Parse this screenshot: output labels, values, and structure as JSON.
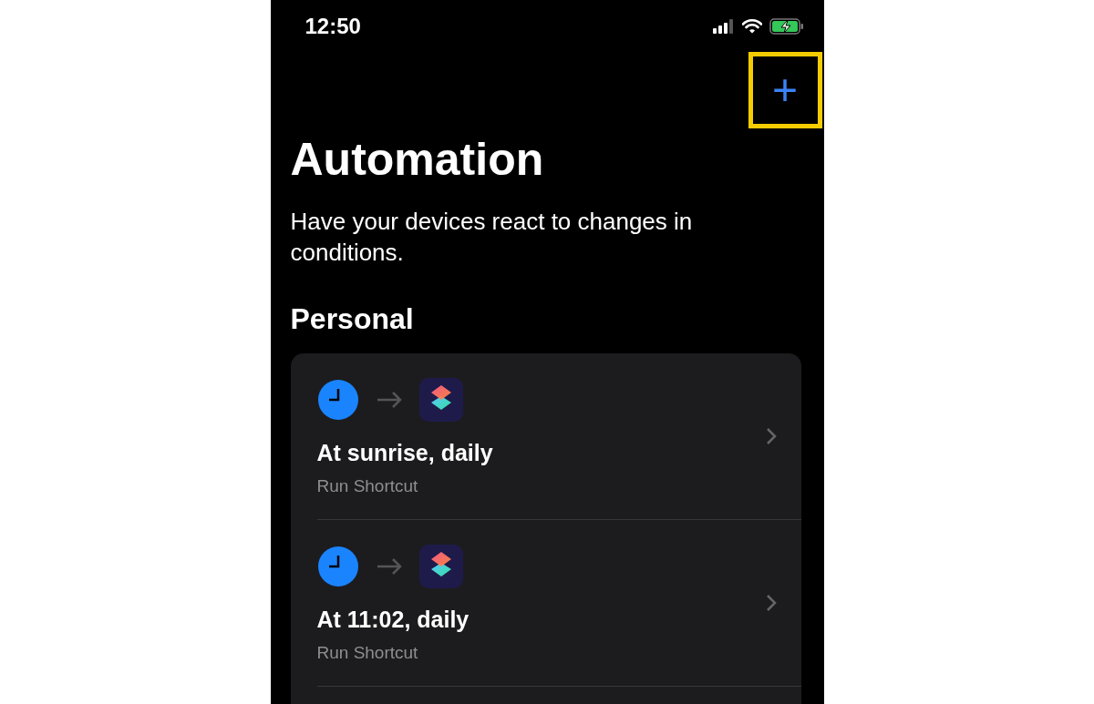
{
  "status_bar": {
    "time": "12:50"
  },
  "add_button": {
    "label": "+",
    "highlighted": true
  },
  "title": "Automation",
  "subtitle": "Have your devices react to changes in conditions.",
  "section": "Personal",
  "automations": [
    {
      "title": "At sunrise, daily",
      "action": "Run Shortcut"
    },
    {
      "title": "At 11:02, daily",
      "action": "Run Shortcut"
    }
  ]
}
